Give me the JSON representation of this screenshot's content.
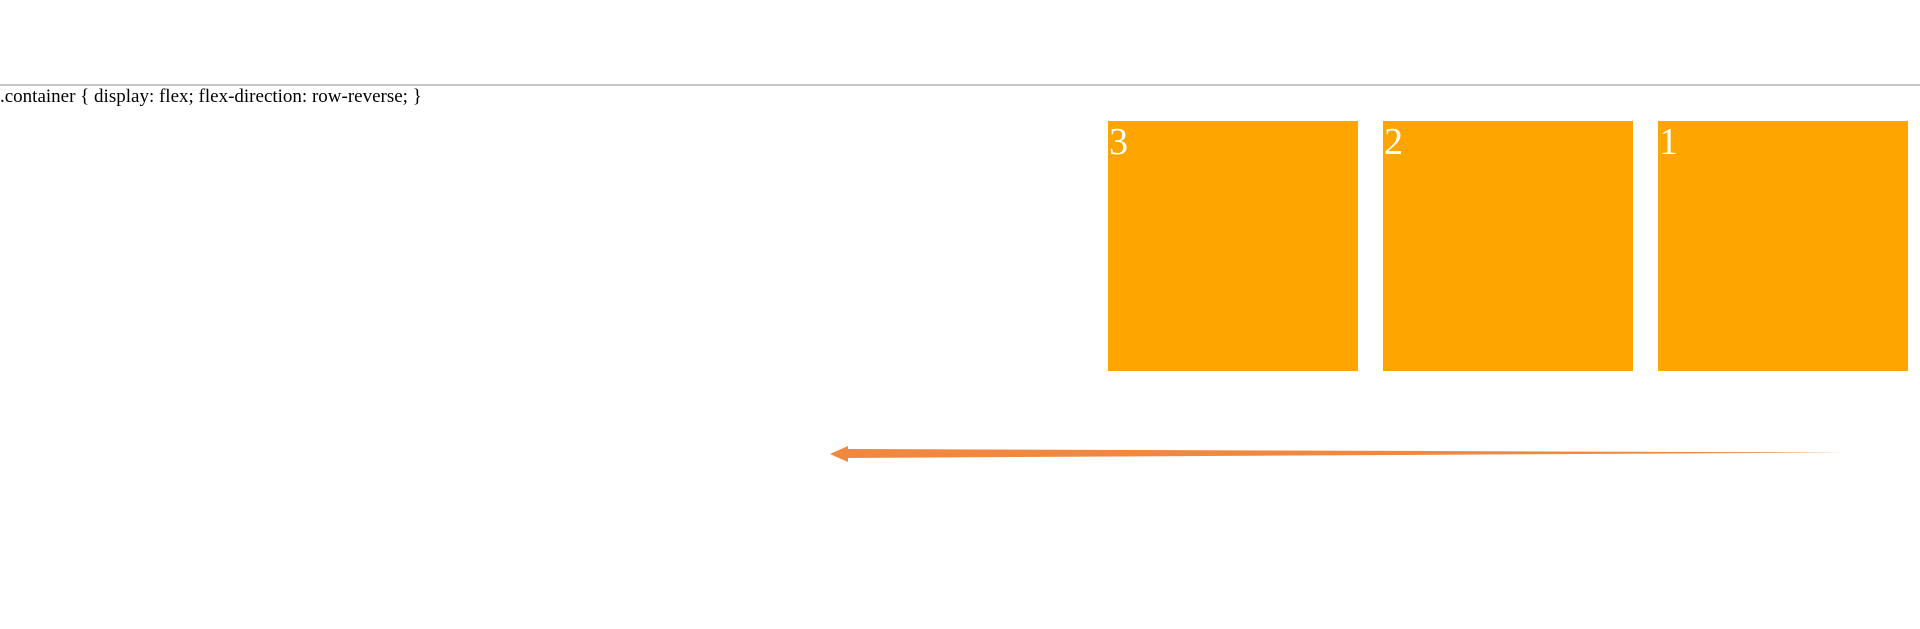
{
  "code": {
    "text": ".container { display: flex; flex-direction: row-reverse; }"
  },
  "boxes": [
    {
      "label": "1"
    },
    {
      "label": "2"
    },
    {
      "label": "3"
    }
  ],
  "arrow": {
    "direction": "right-to-left",
    "icon": "left-arrow-icon"
  },
  "colors": {
    "box": "#ffa500",
    "arrow": "#f08840",
    "divider": "#c8c8c8",
    "text": "#000000"
  }
}
